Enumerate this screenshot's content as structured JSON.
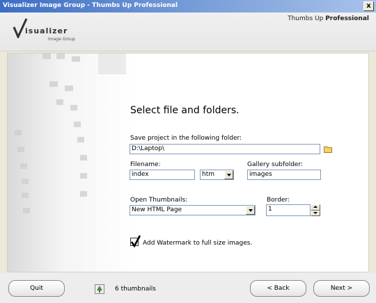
{
  "window": {
    "title": "Visualizer Image Group - Thumbs Up Professional",
    "close_label": "x"
  },
  "header": {
    "logo_name": "isualizer",
    "logo_sub": "Image Group",
    "product_prefix": "Thumbs Up",
    "product_bold": "Professional"
  },
  "main": {
    "heading": "Select file and folders.",
    "save_label": "Save project in the following folder:",
    "save_value": "D:\\Laptop\\",
    "filename_label": "Filename:",
    "filename_value": "index",
    "extension_value": "htm",
    "gallery_label": "Gallery subfolder:",
    "gallery_value": "images",
    "open_label": "Open Thumbnails:",
    "open_value": "New HTML Page",
    "border_label": "Border:",
    "border_value": "1",
    "watermark_label": "Add Watermark to full size images.",
    "watermark_checked": true
  },
  "footer": {
    "quit_label": "Quit",
    "thumbs_text": "6 thumbnails",
    "back_label": "< Back",
    "next_label": "Next >"
  },
  "colors": {
    "title_start": "#3d6ec4",
    "title_end": "#a9c2ea",
    "field_border": "#7f9db9"
  }
}
